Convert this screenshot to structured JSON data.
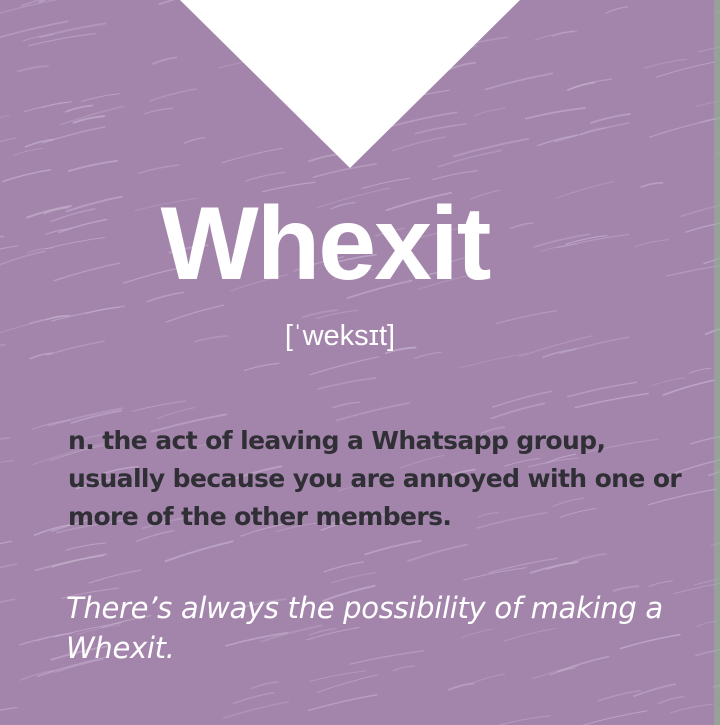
{
  "word": "Whexit",
  "phonetic": "[ˈweksɪt]",
  "definition": "n. the act of leaving a Whatsapp group, usually because you are annoyed with one or more of the other members.",
  "example": "There’s always the possibility of making a Whexit.",
  "colors": {
    "background": "#a385ac",
    "texture_lines": "#c4aecb",
    "notch": "#ffffff",
    "title_text": "#ffffff",
    "definition_text": "#2f2f35",
    "edge_strip": "#8cba8a"
  }
}
